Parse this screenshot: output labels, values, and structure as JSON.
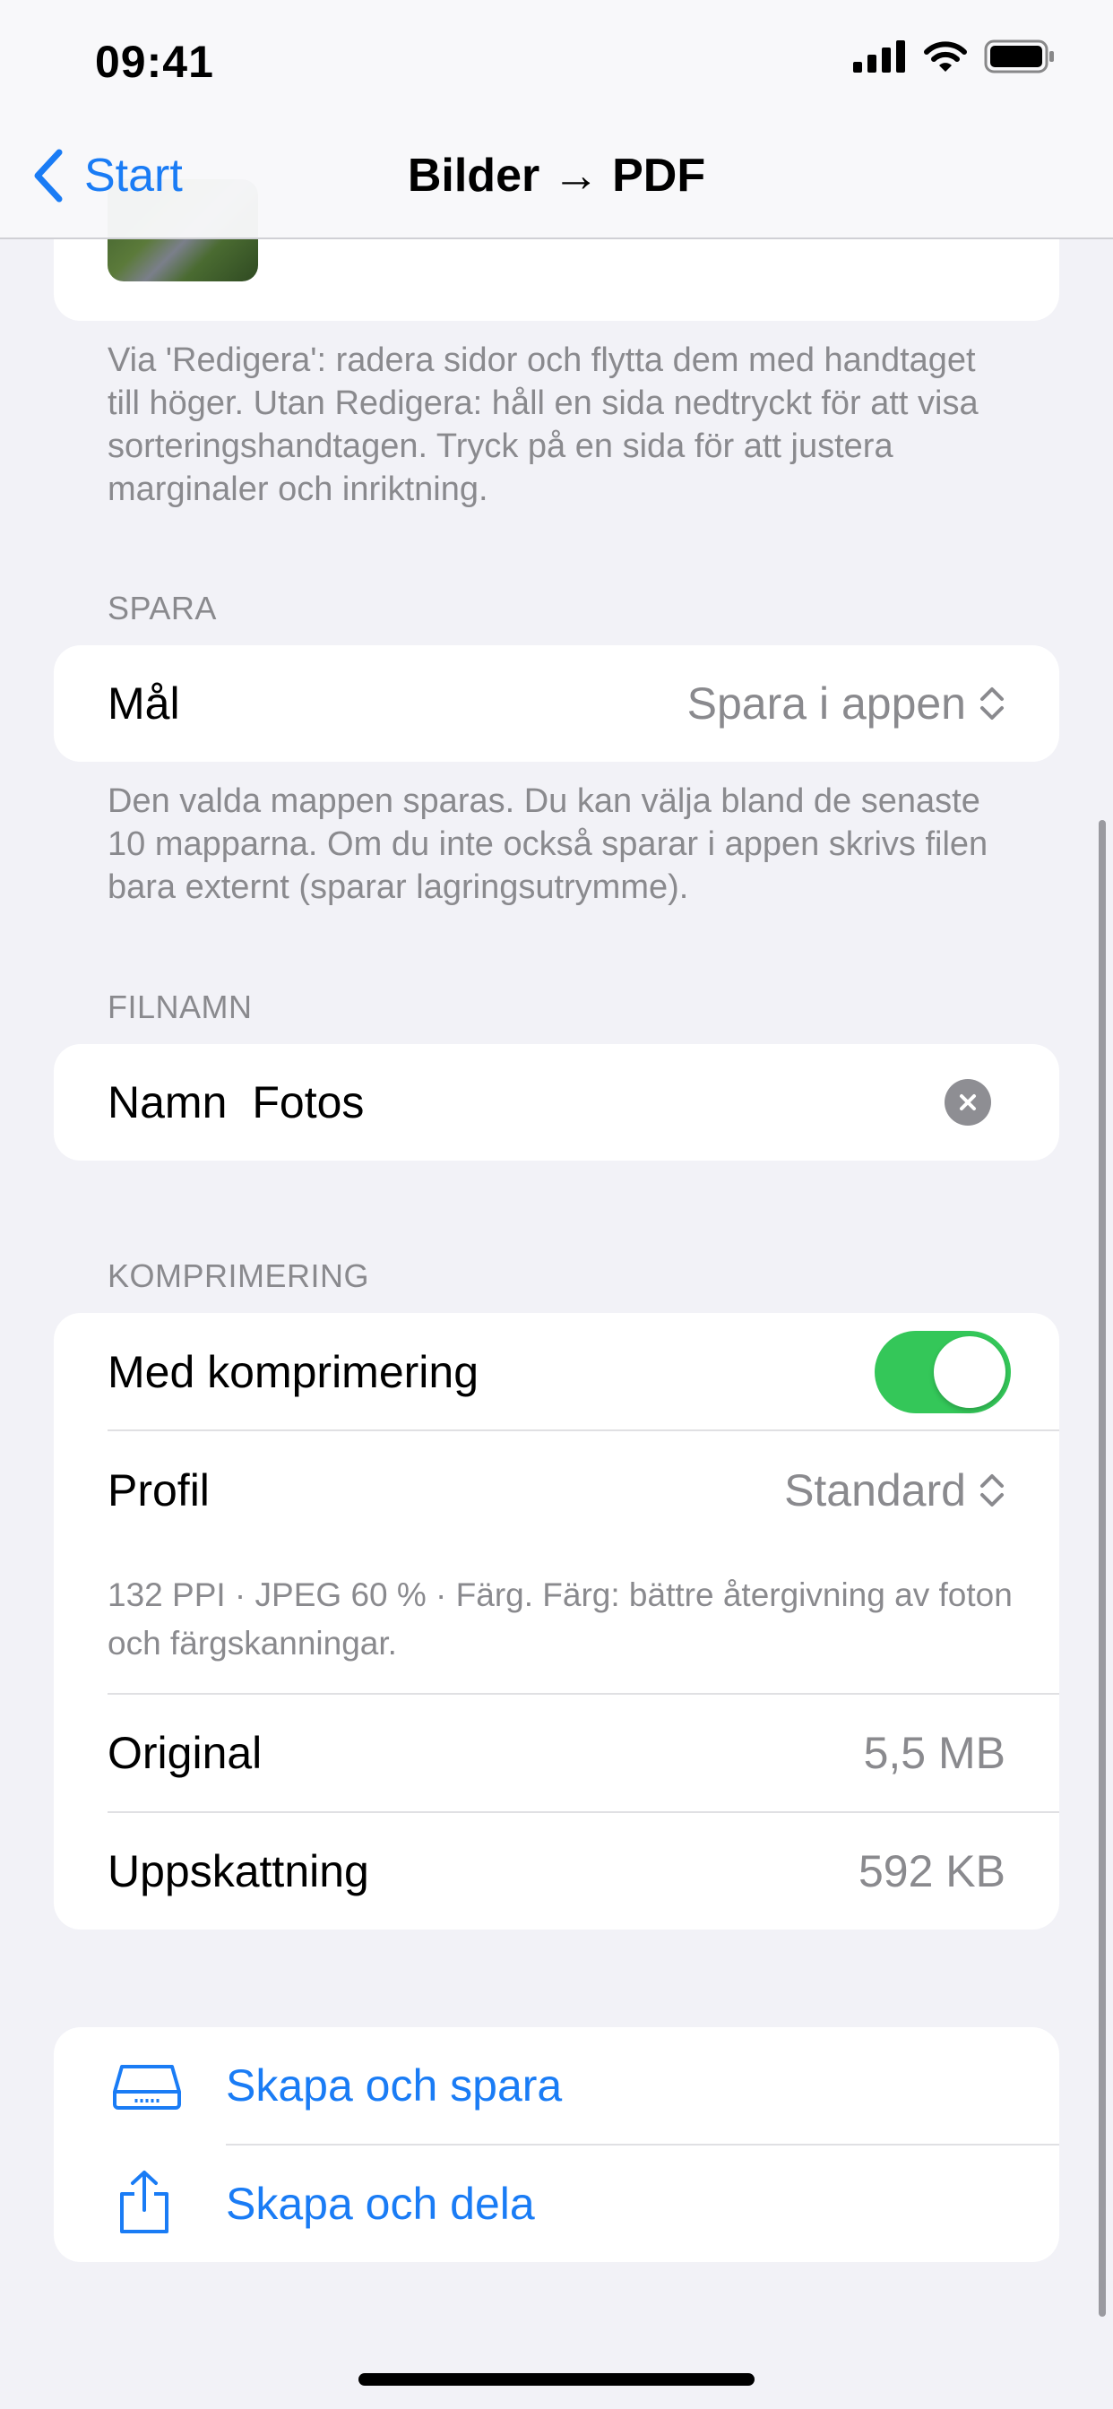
{
  "status_bar": {
    "time": "09:41"
  },
  "nav": {
    "back_label": "Start",
    "title": "Bilder → PDF"
  },
  "pages_footer": "Via 'Redigera': radera sidor och flytta dem med handtaget till höger. Utan Redigera: håll en sida nedtryckt för att visa sorteringshandtagen. Tryck på en sida för att justera marginaler och inriktning.",
  "save": {
    "header": "SPARA",
    "target_label": "Mål",
    "target_value": "Spara i appen",
    "footer": "Den valda mappen sparas. Du kan välja bland de senaste 10 mapparna. Om du inte också sparar i appen skrivs filen bara externt (sparar lagringsutrymme)."
  },
  "filename": {
    "header": "FILNAMN",
    "label": "Namn",
    "value": "Fotos"
  },
  "compression": {
    "header": "KOMPRIMERING",
    "toggle_label": "Med komprimering",
    "toggle_on": true,
    "profile_label": "Profil",
    "profile_value": "Standard",
    "profile_desc": "132 PPI · JPEG 60 % · Färg. Färg: bättre återgivning av foton och färgskanningar.",
    "original_label": "Original",
    "original_value": "5,5 MB",
    "estimate_label": "Uppskattning",
    "estimate_value": "592 KB"
  },
  "actions": {
    "create_save": "Skapa och spara",
    "create_share": "Skapa och dela"
  },
  "colors": {
    "accent": "#1a7cf5",
    "toggle_on": "#34c759",
    "secondary_text": "#8a8a8e"
  },
  "icons": [
    "chevron-left-icon",
    "updown-chevron-icon",
    "clear-icon",
    "drive-icon",
    "share-icon"
  ]
}
